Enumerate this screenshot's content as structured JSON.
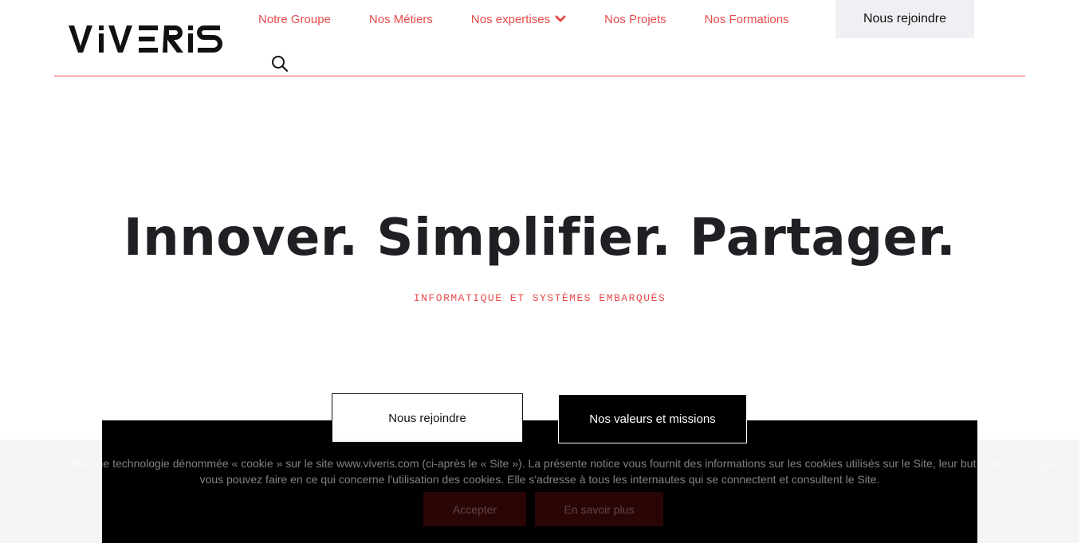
{
  "brand": {
    "name": "VIVERIS",
    "accent": "#e74c4c"
  },
  "nav": {
    "items": [
      {
        "label": "Notre Groupe"
      },
      {
        "label": "Nos Métiers"
      },
      {
        "label": "Nos expertises"
      },
      {
        "label": "Nos Projets"
      },
      {
        "label": "Nos Formations"
      }
    ],
    "join_label": "Nous rejoindre",
    "search_icon": "search-icon",
    "dropdown_icon": "chevron-down-icon"
  },
  "hero": {
    "title": "Innover. Simplifier. Partager.",
    "subtitle": "INFORMATIQUE ET SYSTÈMES EMBARQUÉS",
    "cta_primary": "Nous rejoindre",
    "cta_secondary": "Nos valeurs et missions"
  },
  "cookie": {
    "text": "Viveris utilise une technologie dénommée « cookie » sur le site www.viveris.com (ci-après le « Site »). La présente notice vous fournit des informations sur les cookies utilisés sur le Site, leur but et les choix que vous pouvez faire en ce qui concerne l'utilisation des cookies. Elle s'adresse à tous les internautes qui se connectent et consultent le Site.",
    "accept_label": "Accepter",
    "more_label": "En savoir plus",
    "close_label": "×"
  }
}
